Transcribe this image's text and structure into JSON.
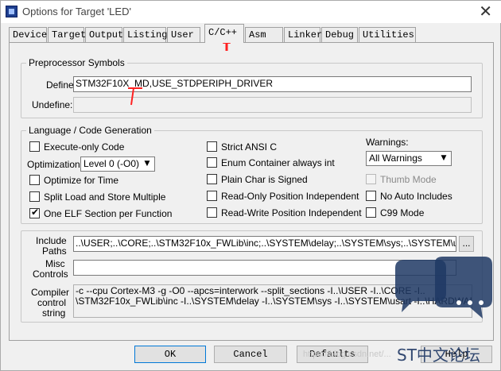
{
  "window": {
    "title": "Options for Target 'LED'",
    "close_glyph": "✕"
  },
  "tabs": [
    "Device",
    "Target",
    "Output",
    "Listing",
    "User",
    "C/C++",
    "Asm",
    "Linker",
    "Debug",
    "Utilities"
  ],
  "active_tab": "C/C++",
  "preprocessor": {
    "group_label": "Preprocessor Symbols",
    "define_label": "Define:",
    "define_value": "STM32F10X_MD,USE_STDPERIPH_DRIVER",
    "undefine_label": "Undefine:",
    "undefine_value": ""
  },
  "language": {
    "group_label": "Language / Code Generation",
    "execute_only": "Execute-only Code",
    "optimization_label": "Optimization:",
    "optimization_value": "Level 0 (-O0)",
    "optimize_time": "Optimize for Time",
    "split_load": "Split Load and Store Multiple",
    "one_elf": "One ELF Section per Function",
    "strict_ansi": "Strict ANSI C",
    "enum_container": "Enum Container always int",
    "plain_char": "Plain Char is Signed",
    "ro_pos": "Read-Only Position Independent",
    "rw_pos": "Read-Write Position Independent",
    "warnings_label": "Warnings:",
    "warnings_value": "All Warnings",
    "thumb_mode": "Thumb Mode",
    "no_auto": "No Auto Includes",
    "c99": "C99 Mode"
  },
  "include": {
    "label_line1": "Include",
    "label_line2": "Paths",
    "value": "..\\USER;..\\CORE;..\\STM32F10x_FWLib\\inc;..\\SYSTEM\\delay;..\\SYSTEM\\sys;..\\SYSTEM\\usart;..\\",
    "browse": "..."
  },
  "misc": {
    "label_line1": "Misc",
    "label_line2": "Controls",
    "value": ""
  },
  "compiler": {
    "label_line1": "Compiler",
    "label_line2": "control",
    "label_line3": "string",
    "line1": "-c --cpu Cortex-M3 -g -O0 --apcs=interwork --split_sections -I..\\USER -I..\\CORE -I..",
    "line2": "\\STM32F10x_FWLib\\inc -I..\\SYSTEM\\delay -I..\\SYSTEM\\sys -I..\\SYSTEM\\usart -I..\\HARDWARE"
  },
  "buttons": {
    "ok": "OK",
    "cancel": "Cancel",
    "defaults": "Defaults",
    "help": "Help"
  },
  "watermark": {
    "text": "ST中文论坛",
    "faint": "https://blog.csdn.net/..."
  },
  "colors": {
    "annotation_arrow": "#ff2020",
    "watermark_logo": "#1f3864",
    "accent": "#0078d7"
  }
}
